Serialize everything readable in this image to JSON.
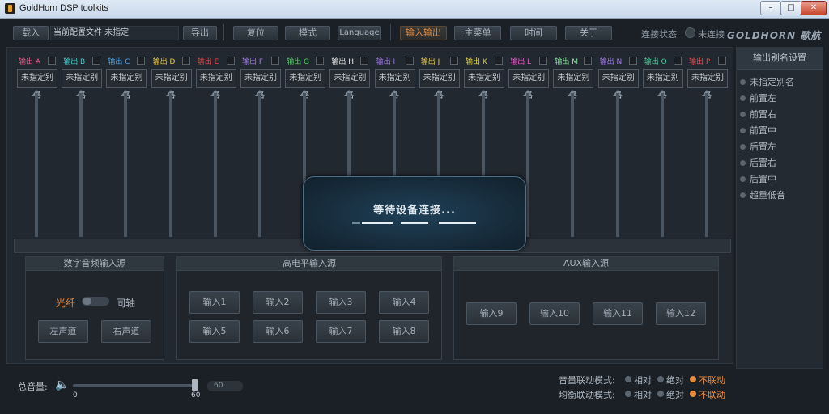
{
  "window": {
    "title": "GoldHorn DSP toolkits",
    "min": "–",
    "max": "□",
    "close": "✕"
  },
  "toolbar": {
    "load": "载入",
    "config_label": "当前配置文件 未指定",
    "export": "导出",
    "reset": "复位",
    "mode": "模式",
    "language": "Language",
    "io": "输入输出",
    "main_menu": "主菜单",
    "time": "时间",
    "about": "关于",
    "conn_label": "连接状态",
    "conn_status": "未连接",
    "logo": "GOLDHORN 歌航"
  },
  "channels": [
    {
      "label": "输出 A",
      "color": "#e85a8a",
      "alias": "未指定别名"
    },
    {
      "label": "输出 B",
      "color": "#48c8c8",
      "alias": "未指定别名"
    },
    {
      "label": "输出 C",
      "color": "#4aa3e8",
      "alias": "未指定别名"
    },
    {
      "label": "输出 D",
      "color": "#e8c84a",
      "alias": "未指定别名"
    },
    {
      "label": "输出 E",
      "color": "#e84a4a",
      "alias": "未指定别名"
    },
    {
      "label": "输出 F",
      "color": "#a07ae8",
      "alias": "未指定别名"
    },
    {
      "label": "输出 G",
      "color": "#5ad06a",
      "alias": "未指定别名"
    },
    {
      "label": "输出 H",
      "color": "#e8e8e8",
      "alias": "未指定别名"
    },
    {
      "label": "输出 I",
      "color": "#a07ae8",
      "alias": "未指定别名"
    },
    {
      "label": "输出 J",
      "color": "#e8c84a",
      "alias": "未指定别名"
    },
    {
      "label": "输出 K",
      "color": "#e8d84a",
      "alias": "未指定别名"
    },
    {
      "label": "输出 L",
      "color": "#e85ac8",
      "alias": "未指定别名"
    },
    {
      "label": "输出 M",
      "color": "#8ae8a0",
      "alias": "未指定别名"
    },
    {
      "label": "输出 N",
      "color": "#a07ae8",
      "alias": "未指定别名"
    },
    {
      "label": "输出 O",
      "color": "#4ad0a0",
      "alias": "未指定别名"
    },
    {
      "label": "输出 P",
      "color": "#e84a4a",
      "alias": "未指定别名"
    }
  ],
  "overlay": {
    "message": "等待设备连接..."
  },
  "panels": {
    "digital": {
      "title": "数字音频输入源",
      "optical": "光纤",
      "coax": "同轴",
      "left": "左声道",
      "right": "右声道"
    },
    "high_level": {
      "title": "高电平输入源",
      "inputs": [
        "输入1",
        "输入2",
        "输入3",
        "输入4",
        "输入5",
        "输入6",
        "输入7",
        "输入8"
      ]
    },
    "aux": {
      "title": "AUX输入源",
      "inputs": [
        "输入9",
        "输入10",
        "输入11",
        "输入12"
      ]
    }
  },
  "sidebar": {
    "title": "输出别名设置",
    "items": [
      "未指定别名",
      "前置左",
      "前置右",
      "前置中",
      "后置左",
      "后置右",
      "后置中",
      "超重低音"
    ]
  },
  "bottom": {
    "volume_label": "总音量:",
    "min": "0",
    "max": "60",
    "value": "60",
    "level": 1.0,
    "vol_link_label": "音量联动模式:",
    "eq_link_label": "均衡联动模式:",
    "opt_relative": "相对",
    "opt_absolute": "绝对",
    "opt_none": "不联动"
  }
}
